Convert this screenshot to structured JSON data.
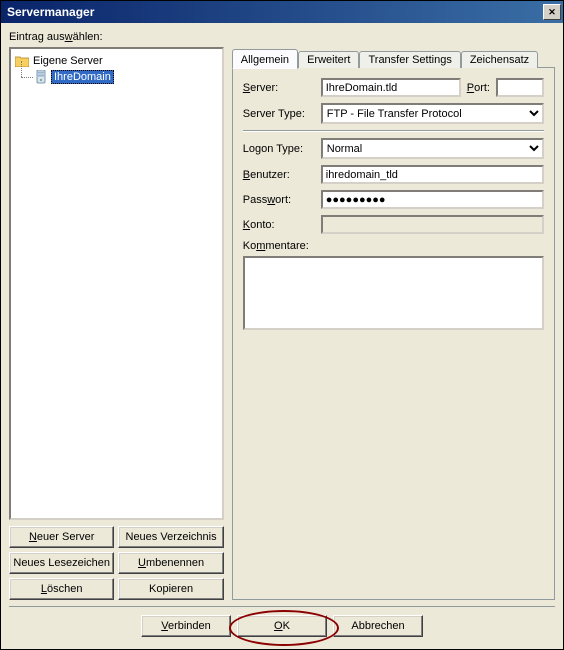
{
  "title": "Servermanager",
  "selectLabel_pre": "Eintrag aus",
  "selectLabel_u": "w",
  "selectLabel_post": "ählen:",
  "tree": {
    "root": "Eigene Server",
    "item": "IhreDomain"
  },
  "leftButtons": {
    "newServer_pre": "",
    "newServer_u": "N",
    "newServer_post": "euer Server",
    "newDir": "Neues Verzeichnis",
    "newBookmark": "Neues Lesezeichen",
    "rename_pre": "",
    "rename_u": "U",
    "rename_post": "mbenennen",
    "delete_pre": "",
    "delete_u": "L",
    "delete_post": "öschen",
    "copy": "Kopieren"
  },
  "tabs": {
    "t1": "Allgemein",
    "t2": "Erweitert",
    "t3": "Transfer Settings",
    "t4": "Zeichensatz"
  },
  "form": {
    "serverLabel_pre": "",
    "serverLabel_u": "S",
    "serverLabel_post": "erver:",
    "serverValue": "IhreDomain.tld",
    "portLabel_pre": "",
    "portLabel_u": "P",
    "portLabel_post": "ort:",
    "portValue": "",
    "serverTypeLabel": "Server Type:",
    "serverTypeValue": "FTP - File Transfer Protocol",
    "logonLabel": "Logon Type:",
    "logonValue": "Normal",
    "userLabel_pre": "",
    "userLabel_u": "B",
    "userLabel_post": "enutzer:",
    "userValue": "ihredomain_tld",
    "passLabel_pre": "Pass",
    "passLabel_u": "w",
    "passLabel_post": "ort:",
    "passValue": "●●●●●●●●●",
    "accountLabel_pre": "",
    "accountLabel_u": "K",
    "accountLabel_post": "onto:",
    "commentsLabel_pre": "Ko",
    "commentsLabel_u": "m",
    "commentsLabel_post": "mentare:",
    "commentsValue": ""
  },
  "bottom": {
    "connect_pre": "",
    "connect_u": "V",
    "connect_post": "erbinden",
    "ok_pre": "",
    "ok_u": "O",
    "ok_post": "K",
    "cancel": "Abbrechen"
  }
}
